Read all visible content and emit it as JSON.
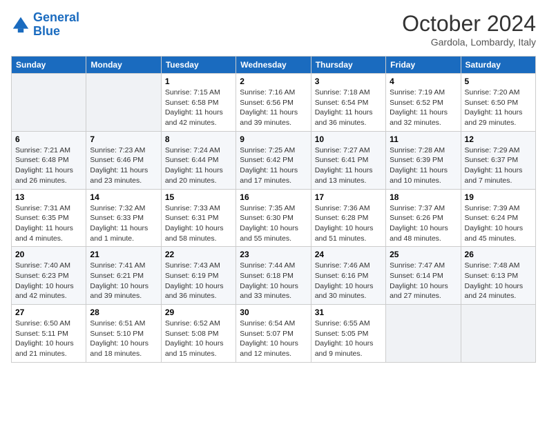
{
  "header": {
    "logo_line1": "General",
    "logo_line2": "Blue",
    "month_year": "October 2024",
    "location": "Gardola, Lombardy, Italy"
  },
  "weekdays": [
    "Sunday",
    "Monday",
    "Tuesday",
    "Wednesday",
    "Thursday",
    "Friday",
    "Saturday"
  ],
  "weeks": [
    [
      {
        "day": "",
        "info": ""
      },
      {
        "day": "",
        "info": ""
      },
      {
        "day": "1",
        "info": "Sunrise: 7:15 AM\nSunset: 6:58 PM\nDaylight: 11 hours and 42 minutes."
      },
      {
        "day": "2",
        "info": "Sunrise: 7:16 AM\nSunset: 6:56 PM\nDaylight: 11 hours and 39 minutes."
      },
      {
        "day": "3",
        "info": "Sunrise: 7:18 AM\nSunset: 6:54 PM\nDaylight: 11 hours and 36 minutes."
      },
      {
        "day": "4",
        "info": "Sunrise: 7:19 AM\nSunset: 6:52 PM\nDaylight: 11 hours and 32 minutes."
      },
      {
        "day": "5",
        "info": "Sunrise: 7:20 AM\nSunset: 6:50 PM\nDaylight: 11 hours and 29 minutes."
      }
    ],
    [
      {
        "day": "6",
        "info": "Sunrise: 7:21 AM\nSunset: 6:48 PM\nDaylight: 11 hours and 26 minutes."
      },
      {
        "day": "7",
        "info": "Sunrise: 7:23 AM\nSunset: 6:46 PM\nDaylight: 11 hours and 23 minutes."
      },
      {
        "day": "8",
        "info": "Sunrise: 7:24 AM\nSunset: 6:44 PM\nDaylight: 11 hours and 20 minutes."
      },
      {
        "day": "9",
        "info": "Sunrise: 7:25 AM\nSunset: 6:42 PM\nDaylight: 11 hours and 17 minutes."
      },
      {
        "day": "10",
        "info": "Sunrise: 7:27 AM\nSunset: 6:41 PM\nDaylight: 11 hours and 13 minutes."
      },
      {
        "day": "11",
        "info": "Sunrise: 7:28 AM\nSunset: 6:39 PM\nDaylight: 11 hours and 10 minutes."
      },
      {
        "day": "12",
        "info": "Sunrise: 7:29 AM\nSunset: 6:37 PM\nDaylight: 11 hours and 7 minutes."
      }
    ],
    [
      {
        "day": "13",
        "info": "Sunrise: 7:31 AM\nSunset: 6:35 PM\nDaylight: 11 hours and 4 minutes."
      },
      {
        "day": "14",
        "info": "Sunrise: 7:32 AM\nSunset: 6:33 PM\nDaylight: 11 hours and 1 minute."
      },
      {
        "day": "15",
        "info": "Sunrise: 7:33 AM\nSunset: 6:31 PM\nDaylight: 10 hours and 58 minutes."
      },
      {
        "day": "16",
        "info": "Sunrise: 7:35 AM\nSunset: 6:30 PM\nDaylight: 10 hours and 55 minutes."
      },
      {
        "day": "17",
        "info": "Sunrise: 7:36 AM\nSunset: 6:28 PM\nDaylight: 10 hours and 51 minutes."
      },
      {
        "day": "18",
        "info": "Sunrise: 7:37 AM\nSunset: 6:26 PM\nDaylight: 10 hours and 48 minutes."
      },
      {
        "day": "19",
        "info": "Sunrise: 7:39 AM\nSunset: 6:24 PM\nDaylight: 10 hours and 45 minutes."
      }
    ],
    [
      {
        "day": "20",
        "info": "Sunrise: 7:40 AM\nSunset: 6:23 PM\nDaylight: 10 hours and 42 minutes."
      },
      {
        "day": "21",
        "info": "Sunrise: 7:41 AM\nSunset: 6:21 PM\nDaylight: 10 hours and 39 minutes."
      },
      {
        "day": "22",
        "info": "Sunrise: 7:43 AM\nSunset: 6:19 PM\nDaylight: 10 hours and 36 minutes."
      },
      {
        "day": "23",
        "info": "Sunrise: 7:44 AM\nSunset: 6:18 PM\nDaylight: 10 hours and 33 minutes."
      },
      {
        "day": "24",
        "info": "Sunrise: 7:46 AM\nSunset: 6:16 PM\nDaylight: 10 hours and 30 minutes."
      },
      {
        "day": "25",
        "info": "Sunrise: 7:47 AM\nSunset: 6:14 PM\nDaylight: 10 hours and 27 minutes."
      },
      {
        "day": "26",
        "info": "Sunrise: 7:48 AM\nSunset: 6:13 PM\nDaylight: 10 hours and 24 minutes."
      }
    ],
    [
      {
        "day": "27",
        "info": "Sunrise: 6:50 AM\nSunset: 5:11 PM\nDaylight: 10 hours and 21 minutes."
      },
      {
        "day": "28",
        "info": "Sunrise: 6:51 AM\nSunset: 5:10 PM\nDaylight: 10 hours and 18 minutes."
      },
      {
        "day": "29",
        "info": "Sunrise: 6:52 AM\nSunset: 5:08 PM\nDaylight: 10 hours and 15 minutes."
      },
      {
        "day": "30",
        "info": "Sunrise: 6:54 AM\nSunset: 5:07 PM\nDaylight: 10 hours and 12 minutes."
      },
      {
        "day": "31",
        "info": "Sunrise: 6:55 AM\nSunset: 5:05 PM\nDaylight: 10 hours and 9 minutes."
      },
      {
        "day": "",
        "info": ""
      },
      {
        "day": "",
        "info": ""
      }
    ]
  ]
}
